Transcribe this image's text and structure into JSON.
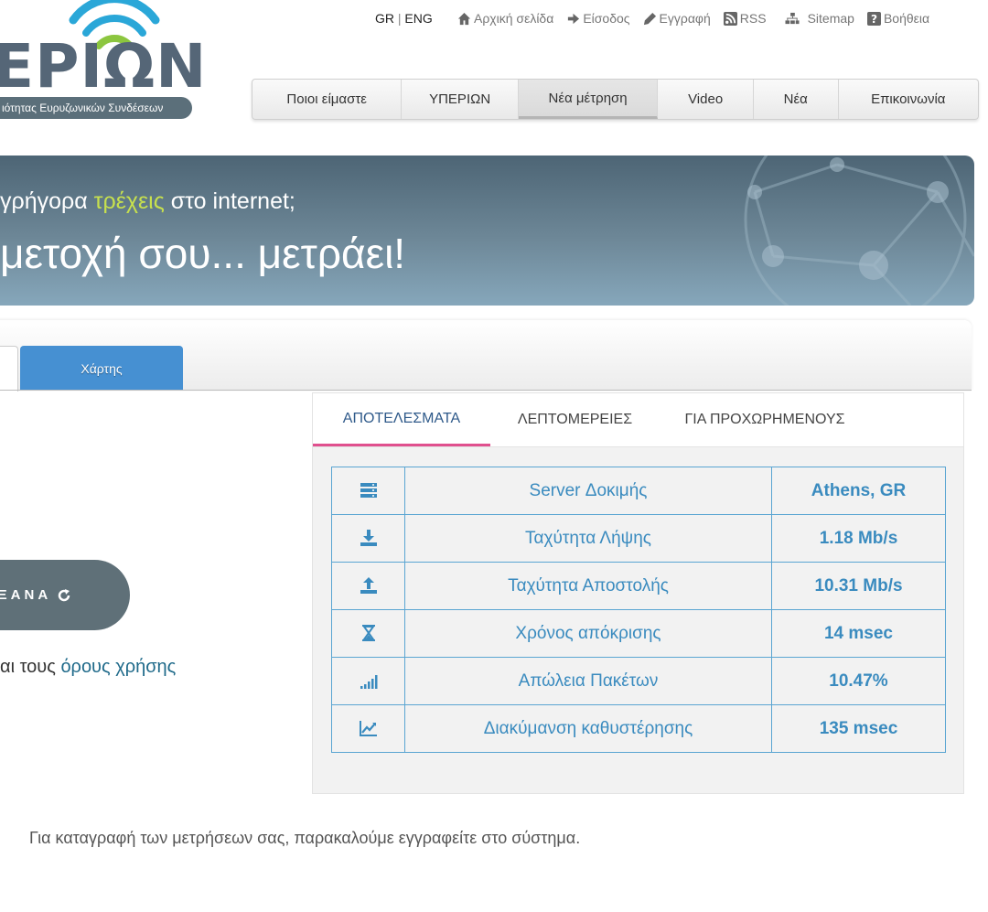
{
  "logo": {
    "word": "ΕΡΙΩΝ",
    "tagline": "ιότητας Ευρυζωνικών Συνδέσεων"
  },
  "language": {
    "gr": "GR",
    "separator": "|",
    "eng": "ENG"
  },
  "top_links": [
    {
      "label": "Αρχική σελίδα",
      "icon": "home-icon"
    },
    {
      "label": "Είσοδος",
      "icon": "login-arrow-icon"
    },
    {
      "label": "Εγγραφή",
      "icon": "pencil-icon"
    },
    {
      "label": "RSS",
      "icon": "rss-icon"
    },
    {
      "label": "Sitemap",
      "icon": "sitemap-icon"
    },
    {
      "label": "Βοήθεια",
      "icon": "help-icon"
    }
  ],
  "main_nav": [
    {
      "label": "Ποιοι είμαστε"
    },
    {
      "label": "ΥΠΕΡΙΩΝ"
    },
    {
      "label": "Νέα μέτρηση",
      "active": true
    },
    {
      "label": "Video"
    },
    {
      "label": "Νέα"
    },
    {
      "label": "Επικοινωνία"
    }
  ],
  "banner": {
    "line1_start": "γρήγορα ",
    "line1_highlight": "τρέχεις",
    "line1_end": " στο internet;",
    "line2": "μετοχή σου... μετράει!"
  },
  "map_tab": {
    "label": "Χάρτης"
  },
  "again_button": {
    "label": "ΞΑΝΑ"
  },
  "terms": {
    "prefix": "αι τους ",
    "link": "όρους χρήσης"
  },
  "results_tabs": [
    {
      "label": "ΑΠΟΤΕΛΕΣΜΑΤΑ",
      "active": true
    },
    {
      "label": "ΛΕΠΤΟΜΕΡΕΙΕΣ"
    },
    {
      "label": "ΓΙΑ ΠΡΟΧΩΡΗΜΕΝΟΥΣ"
    }
  ],
  "results": [
    {
      "icon": "server-icon",
      "label": "Server Δοκιμής",
      "value": "Athens, GR"
    },
    {
      "icon": "download-icon",
      "label": "Ταχύτητα Λήψης",
      "value": "1.18 Mb/s"
    },
    {
      "icon": "upload-icon",
      "label": "Ταχύτητα Αποστολής",
      "value": "10.31 Mb/s"
    },
    {
      "icon": "hourglass-icon",
      "label": "Χρόνος απόκρισης",
      "value": "14 msec"
    },
    {
      "icon": "signal-bars-icon",
      "label": "Απώλεια Πακέτων",
      "value": "10.47%"
    },
    {
      "icon": "trend-chart-icon",
      "label": "Διακύμανση καθυστέρησης",
      "value": "135 msec"
    }
  ],
  "registration_note": "Για καταγραφή των μετρήσεων σας, παρακαλούμε εγγραφείτε στο σύστημα.",
  "colors": {
    "accent_blue": "#4690d2",
    "table_text": "#3a8bbf",
    "tab_indicator": "#e0508e",
    "banner_highlight": "#c7e04e"
  }
}
